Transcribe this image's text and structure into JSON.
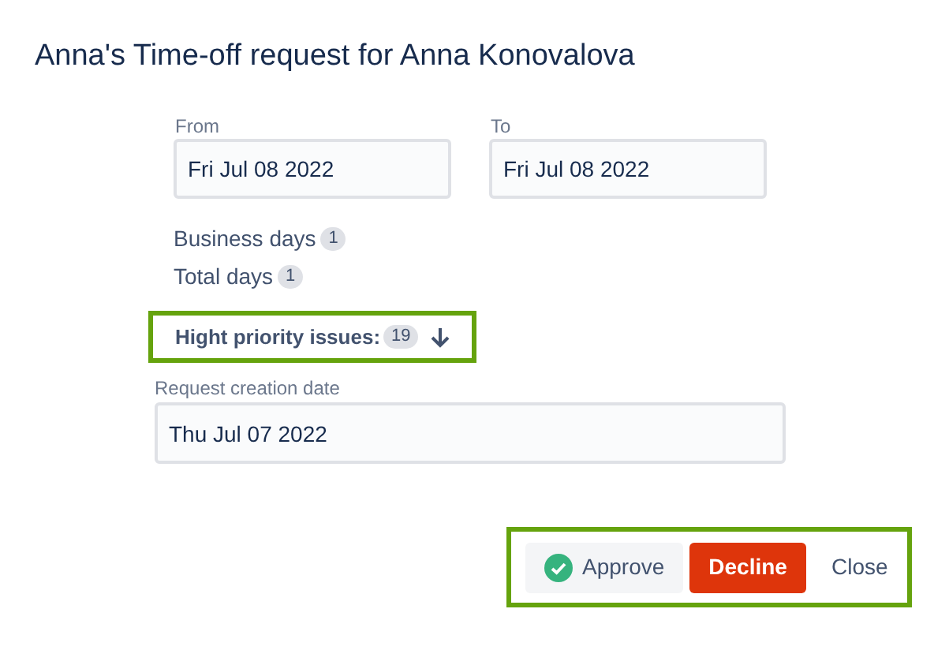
{
  "title": "Anna's Time-off request for Anna Konovalova",
  "from": {
    "label": "From",
    "value": "Fri Jul 08 2022"
  },
  "to": {
    "label": "To",
    "value": "Fri Jul 08 2022"
  },
  "business_days": {
    "label": "Business days",
    "count": "1"
  },
  "total_days": {
    "label": "Total days",
    "count": "1"
  },
  "high_priority": {
    "label": "Hight priority issues:",
    "count": "19",
    "highlighted": true
  },
  "creation_date": {
    "label": "Request creation date",
    "value": "Thu Jul 07 2022"
  },
  "buttons": [
    {
      "label": "Approve",
      "kind": "approve"
    },
    {
      "label": "Decline",
      "kind": "decline"
    },
    {
      "label": "Close",
      "kind": "close"
    }
  ],
  "buttons_highlighted": true
}
